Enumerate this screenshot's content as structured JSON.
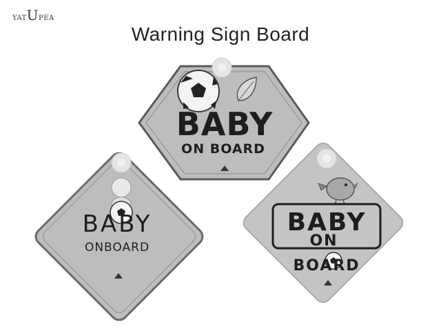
{
  "brand": {
    "first": "YAT",
    "middle": "U",
    "last": "PEA"
  },
  "title": "Warning Sign Board",
  "signs": [
    {
      "line1": "BABY",
      "line2": "ON BOARD"
    },
    {
      "line1": "BABY",
      "line2": "ONBOARD"
    },
    {
      "line1": "BABY",
      "line2": "ON",
      "line3": "BOARD"
    }
  ],
  "colors": {
    "sign_fill": "#bdbdbd",
    "sign_border": "#5a5a5a",
    "text": "#1e1e1e"
  }
}
